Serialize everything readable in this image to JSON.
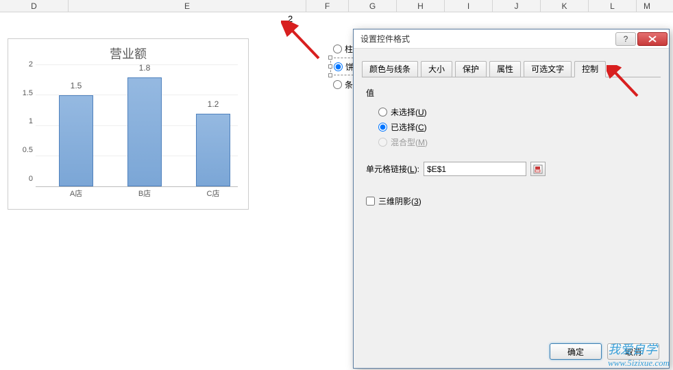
{
  "columns": [
    "D",
    "E",
    "F",
    "G",
    "H",
    "I",
    "J",
    "K",
    "L",
    "M"
  ],
  "cell_e1": "2",
  "chart_data": {
    "type": "bar",
    "title": "营业额",
    "categories": [
      "A店",
      "B店",
      "C店"
    ],
    "values": [
      1.5,
      1.8,
      1.2
    ],
    "ylim": [
      0,
      2
    ],
    "ystep": 0.5,
    "yticks": [
      0,
      0.5,
      1,
      1.5,
      2
    ]
  },
  "sheet_radios": {
    "items": [
      {
        "label": "柱形图",
        "checked": false,
        "selected": false
      },
      {
        "label": "饼图",
        "checked": true,
        "selected": true
      },
      {
        "label": "条形图",
        "checked": false,
        "selected": false
      }
    ]
  },
  "dialog": {
    "title": "设置控件格式",
    "tabs": [
      {
        "label": "颜色与线条",
        "active": false
      },
      {
        "label": "大小",
        "active": false
      },
      {
        "label": "保护",
        "active": false
      },
      {
        "label": "属性",
        "active": false
      },
      {
        "label": "可选文字",
        "active": false
      },
      {
        "label": "控制",
        "active": true
      }
    ],
    "value_group_label": "值",
    "value_options": [
      {
        "label": "未选择(",
        "key": "U",
        "tail": ")",
        "checked": false,
        "disabled": false
      },
      {
        "label": "已选择(",
        "key": "C",
        "tail": ")",
        "checked": true,
        "disabled": false
      },
      {
        "label": "混合型(",
        "key": "M",
        "tail": ")",
        "checked": false,
        "disabled": true
      }
    ],
    "cell_link_label": "单元格链接(",
    "cell_link_key": "L",
    "cell_link_tail": "):",
    "cell_link_value": "$E$1",
    "shadow_label": "三维阴影(",
    "shadow_key": "3",
    "shadow_tail": ")",
    "shadow_checked": false,
    "ok_label": "确定",
    "cancel_label": "取消",
    "help_label": "?"
  },
  "watermark": {
    "line1": "我爱自学",
    "line2": "www.5izixue.com"
  }
}
